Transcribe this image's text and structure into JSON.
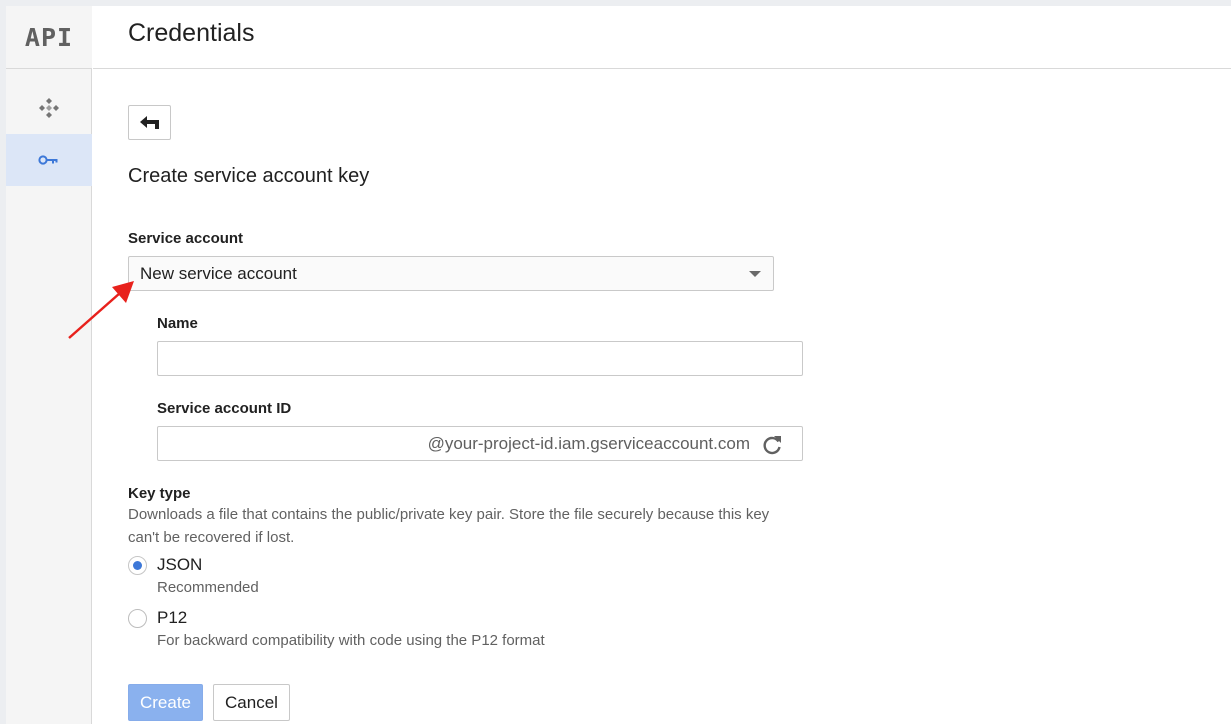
{
  "sidebar": {
    "logo": "API",
    "items": [
      {
        "icon": "dashboard-diamond-icon",
        "active": false
      },
      {
        "icon": "key-icon",
        "active": true
      }
    ]
  },
  "header": {
    "title": "Credentials"
  },
  "form": {
    "back_icon": "back-arrow-icon",
    "heading": "Create service account key",
    "service_account_label": "Service account",
    "service_account_value": "New service account",
    "name_label": "Name",
    "name_value": "",
    "service_account_id_label": "Service account ID",
    "service_account_id_value": "",
    "service_account_id_suffix": "@your-project-id.iam.gserviceaccount.com",
    "key_type_label": "Key type",
    "key_type_help": "Downloads a file that contains the public/private key pair. Store the file securely because this key can't be recovered if lost.",
    "options": [
      {
        "label": "JSON",
        "description": "Recommended",
        "selected": true
      },
      {
        "label": "P12",
        "description": "For backward compatibility with code using the P12 format",
        "selected": false
      }
    ],
    "create_label": "Create",
    "cancel_label": "Cancel"
  },
  "colors": {
    "accent": "#3d78d8",
    "create_button": "#8ab1ee",
    "active_rail": "#dce6f7",
    "annotation_arrow": "#e8211c"
  }
}
